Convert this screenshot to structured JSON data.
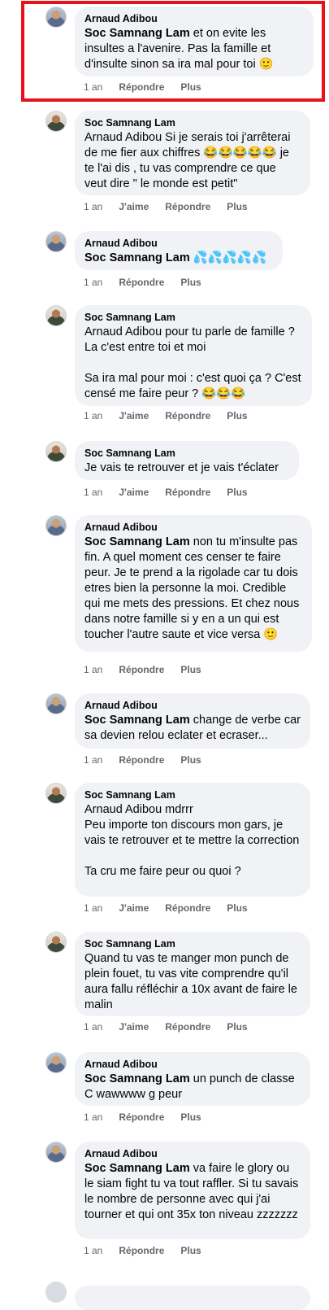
{
  "actions": {
    "time": "1 an",
    "like": "J'aime",
    "reply": "Répondre",
    "more": "Plus"
  },
  "comments": [
    {
      "author": "Arnaud Adibou",
      "mention": "Soc Samnang Lam",
      "text": " et on evite les insultes a l'avenire. Pas la famille et d'insulte sinon sa ira mal pour toi 🙂",
      "hasLike": false
    },
    {
      "author": "Soc Samnang Lam",
      "mention": "",
      "text": "Arnaud Adibou Si je serais toi j'arrêterai de me fier aux chiffres 😂😂😂😂😂 je te l'ai dis , tu vas comprendre ce que veut dire \" le monde est petit\"",
      "hasLike": true
    },
    {
      "author": "Arnaud Adibou",
      "mention": "Soc Samnang Lam",
      "text": " 💦💦💦💦💦",
      "hasLike": false
    },
    {
      "author": "Soc Samnang Lam",
      "mention": "",
      "text": "Arnaud Adibou pour tu parle de famille ? La c'est entre toi et moi\n\nSa ira mal pour moi : c'est quoi ça ? C'est censé me faire peur ? 😂😂😂",
      "hasLike": true
    },
    {
      "author": "Soc Samnang Lam",
      "mention": "",
      "text": "Je vais te retrouver et je vais t'éclater",
      "hasLike": true
    },
    {
      "author": "Arnaud Adibou",
      "mention": "Soc Samnang Lam",
      "text": " non tu m'insulte pas fin. A quel moment ces censer te faire peur. Je te prend a la rigolade car tu dois etres bien la personne la moi. Credible qui me mets des pressions. Et chez nous dans notre famille si y en a un qui est toucher l'autre saute et vice versa 🙂",
      "hasLike": false
    },
    {
      "author": "Arnaud Adibou",
      "mention": "Soc Samnang Lam",
      "text": " change de verbe car sa devien relou eclater et ecraser...",
      "hasLike": false
    },
    {
      "author": "Soc Samnang Lam",
      "mention": "",
      "text": "Arnaud Adibou mdrrr\nPeu importe ton discours mon gars, je vais te retrouver et te mettre la correction\n\nTa cru me faire peur ou quoi ?",
      "hasLike": true
    },
    {
      "author": "Soc Samnang Lam",
      "mention": "",
      "text": "Quand tu vas te manger mon punch de plein fouet, tu vas vite comprendre qu'il aura fallu réfléchir a 10x avant de faire le malin",
      "hasLike": true
    },
    {
      "author": "Arnaud Adibou",
      "mention": "Soc Samnang Lam",
      "text": " un punch de classe C wawwww g peur",
      "hasLike": false
    },
    {
      "author": "Arnaud Adibou",
      "mention": "Soc Samnang Lam",
      "text": " va faire le glory ou le siam fight tu va tout raffler. Si tu savais le nombre de personne avec qui j'ai tourner et qui ont 35x ton niveau zzzzzzz",
      "hasLike": false
    }
  ]
}
